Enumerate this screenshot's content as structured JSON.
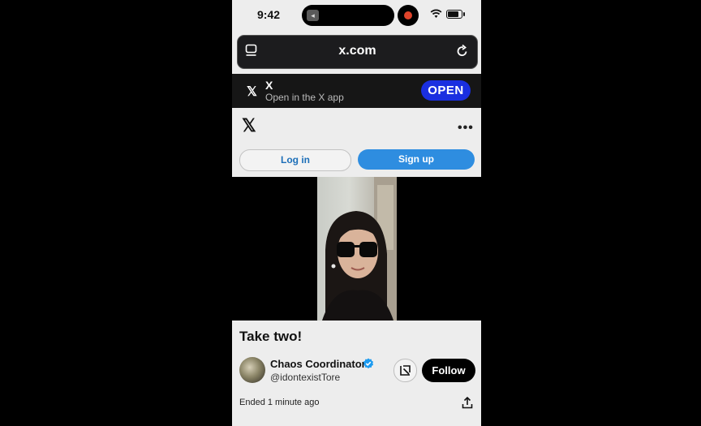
{
  "status_bar": {
    "time": "9:42"
  },
  "browser": {
    "url": "x.com"
  },
  "app_banner": {
    "logo": "𝕏",
    "title": "X",
    "subtitle": "Open in the X app",
    "open_label": "OPEN"
  },
  "header": {
    "logo": "𝕏",
    "more": "•••"
  },
  "auth": {
    "login_label": "Log in",
    "signup_label": "Sign up"
  },
  "post": {
    "caption": "Take two!",
    "author_name": "Chaos Coordinator",
    "author_handle": "@idontexistTore",
    "follow_label": "Follow",
    "status": "Ended 1 minute ago"
  },
  "colors": {
    "open_button": "#1a2fe0",
    "signup_button": "#2e8de0",
    "login_text": "#1d6fb8",
    "verified_badge": "#1d9bf0",
    "record_dot": "#e0442b"
  },
  "icons": {
    "tabs": "tabs-icon",
    "reload": "reload-icon",
    "more": "more-icon",
    "verified": "verified-badge-icon",
    "open_post": "open-in-new-icon",
    "share": "share-icon"
  }
}
